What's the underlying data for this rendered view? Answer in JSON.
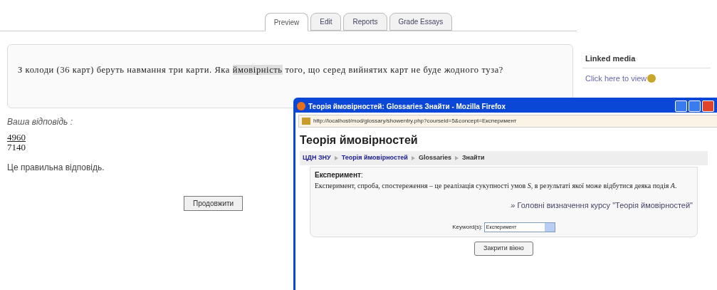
{
  "tabs": [
    {
      "label": "Preview",
      "selected": true
    },
    {
      "label": "Edit",
      "selected": false
    },
    {
      "label": "Reports",
      "selected": false
    },
    {
      "label": "Grade Essays",
      "selected": false
    }
  ],
  "question": {
    "before": "З колоди (36 карт) беруть навмання три карти. Яка",
    "link": "ймовірність",
    "after": "того, що серед вийнятих карт не буде жодного туза?"
  },
  "answer_label": "Ваша відповідь :",
  "fraction": {
    "numerator": "4960",
    "denominator": "7140"
  },
  "feedback": "Це правильна відповідь.",
  "continue_button": "Продовжити",
  "linked_media": {
    "title": "Linked media",
    "link": "Click here to view"
  },
  "popup": {
    "title": "Теорія ймовірностей: Glossaries Знайти - Mozilla Firefox",
    "url": "http://localhost/mod/glossary/showentry.php?courseid=5&concept=Експеримент",
    "heading": "Теорія ймовірностей",
    "breadcrumb": [
      {
        "label": "ЦДН ЗНУ",
        "link": true
      },
      {
        "label": "Теорія ймовірностей",
        "link": true
      },
      {
        "label": "Glossaries",
        "link": false
      },
      {
        "label": "Знайти",
        "link": false
      }
    ],
    "entry_term": "Експеримент",
    "entry_colon": ":",
    "definition": "Експеримент, спроба, спостереження – це реалізація сукупності умов *S*, в результаті якої може відбутися деяка подія *A*.",
    "course_link": "» Головні визначення курсу \"Теорія ймовірностей\"",
    "keyword_label": "Keyword(s):",
    "keyword_value": "Експеримент",
    "close_button": "Закрити вікно"
  }
}
